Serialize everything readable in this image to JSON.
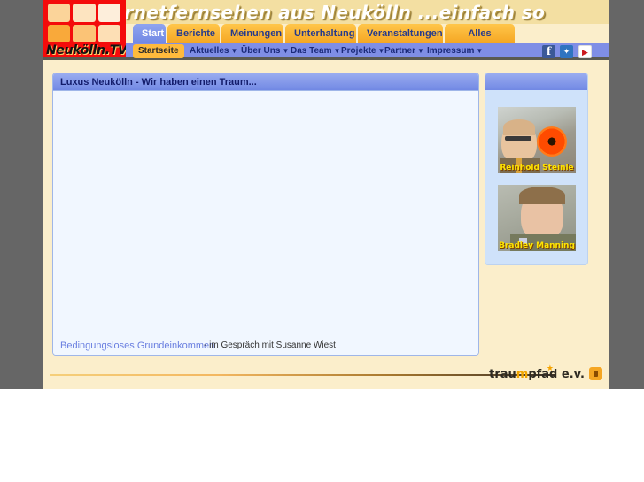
{
  "site": {
    "logo_text": "Neukölln.TV",
    "tagline": "Internetfernsehen aus Neukölln ...einfach so"
  },
  "nav": {
    "tabs": [
      {
        "label": "Start",
        "active": true
      },
      {
        "label": "Berichte",
        "active": false
      },
      {
        "label": "Meinungen",
        "active": false
      },
      {
        "label": "Unterhaltung",
        "active": false
      },
      {
        "label": "Veranstaltungen",
        "active": false
      },
      {
        "label": "Alles Andere",
        "active": false
      }
    ],
    "subitems": [
      {
        "label": "Startseite",
        "active": true,
        "dropdown": false
      },
      {
        "label": "Aktuelles",
        "active": false,
        "dropdown": true
      },
      {
        "label": "Über Uns",
        "active": false,
        "dropdown": true
      },
      {
        "label": "Das Team",
        "active": false,
        "dropdown": true
      },
      {
        "label": "Projekte",
        "active": false,
        "dropdown": true
      },
      {
        "label": "Partner",
        "active": false,
        "dropdown": true
      },
      {
        "label": "Impressum",
        "active": false,
        "dropdown": true
      }
    ],
    "social": [
      {
        "name": "facebook-icon",
        "glyph": "f"
      },
      {
        "name": "myspace-icon",
        "glyph": "❄"
      },
      {
        "name": "youtube-icon",
        "glyph": "▶"
      }
    ]
  },
  "main": {
    "panel_title": "Luxus Neukölln - Wir haben einen Traum...",
    "caption_link": "Bedingungsloses Grundeinkommen",
    "caption_rest": "- im Gespräch mit Susanne Wiest"
  },
  "sidebar": {
    "header_title": "",
    "thumbnails": [
      {
        "label": "Reinhold Steinle"
      },
      {
        "label": "Bradley Manning"
      }
    ]
  },
  "footer": {
    "brand_pre": "trau",
    "brand_hl": "m",
    "brand_post": "pfad e.v.",
    "badge": "lock-badge-icon"
  },
  "colors": {
    "desktop": "#666666",
    "page_bg": "#fbeecb",
    "header_band": "#f3dfa2",
    "logo_red": "#f40b0b",
    "tab_orange": "#f5a623",
    "tab_active_blue": "#7188e4",
    "submenu_blue": "#7f8ee6",
    "panel_blue": "#7188e4",
    "panel_body": "#f1f7ff",
    "sidebar_bg": "#cfe2fa",
    "link_blue": "#6a7fe0",
    "caption_yellow": "#ffe400"
  }
}
